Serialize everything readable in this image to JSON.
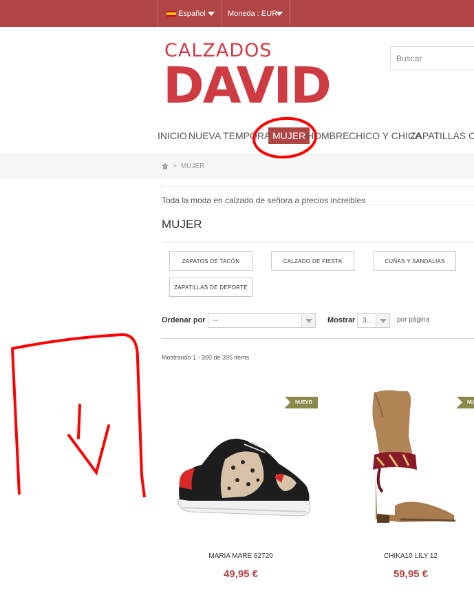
{
  "topbar": {
    "language": "Español",
    "currency": "Moneda : EUR"
  },
  "logo": {
    "line1": "CALZADOS",
    "line2": "DAVID"
  },
  "search": {
    "placeholder": "Buscar"
  },
  "nav": {
    "items": [
      {
        "label": "INICIO"
      },
      {
        "label": "NUEVA TEMPORADA"
      },
      {
        "label": "MUJER",
        "active": true
      },
      {
        "label": "HOMBRE"
      },
      {
        "label": "CHICO Y CHICA"
      },
      {
        "label": "ZAPATILLAS CASA"
      }
    ]
  },
  "breadcrumb": {
    "separator": ">",
    "current": "MUJER"
  },
  "category": {
    "description": "Toda la moda en calzado de señora a precios increibles",
    "title": "MUJER",
    "subcategories": [
      "ZAPATOS DE TACÓN",
      "CALZADO DE FIESTA",
      "CUÑAS Y SANDALIAS",
      "ZAPATILLAS DE DEPORTE"
    ]
  },
  "sorting": {
    "sort_label": "Ordenar por",
    "sort_value": "--",
    "show_label": "Mostrar",
    "show_value": "3...",
    "per_page": "por página",
    "showing": "Mostrando 1 - 300 de 395 items"
  },
  "products": [
    {
      "badge": "NUEVO",
      "name": "MARIA MARE 62720",
      "price": "49,95 €"
    },
    {
      "badge": "NUEVO",
      "name": "CHIKA10 LILY 12",
      "price": "59,95 €"
    }
  ],
  "colors": {
    "brand": "#b04545",
    "logo": "#cf3b43",
    "badge": "#8b8a4c",
    "annotation": "#ff0000"
  }
}
